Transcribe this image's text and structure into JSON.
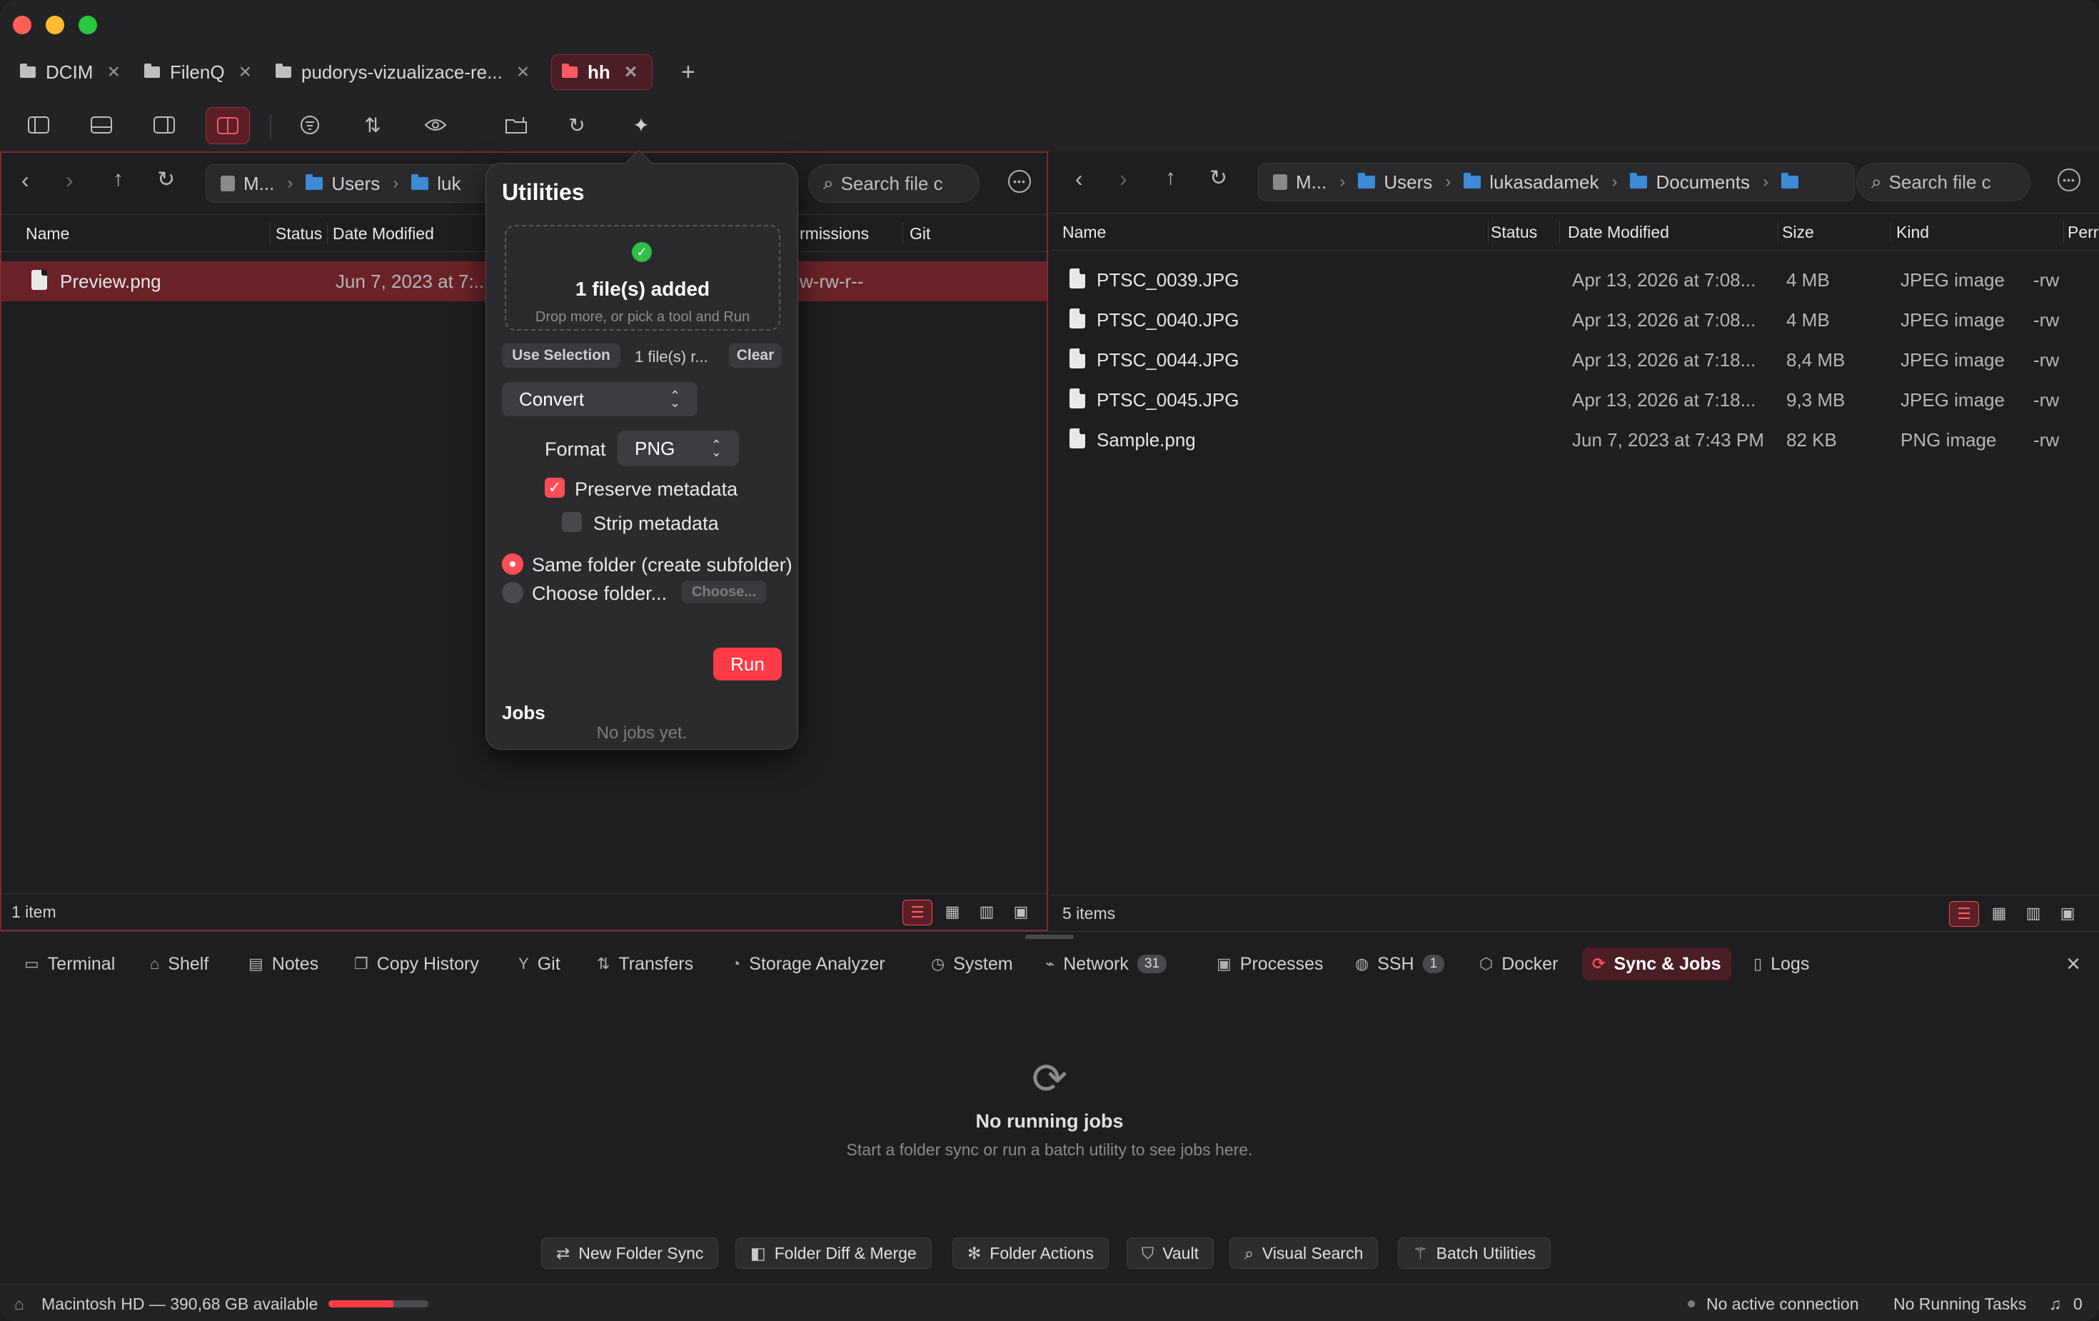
{
  "tabs": [
    {
      "label": "DCIM",
      "active": false
    },
    {
      "label": "FilenQ",
      "active": false
    },
    {
      "label": "pudorys-vizualizace-re...",
      "active": false
    },
    {
      "label": "hh",
      "active": true
    }
  ],
  "toolbar": {
    "icons": [
      "sidebar-toggle-icon",
      "top-panel-icon",
      "right-panel-icon",
      "dual-pane-icon",
      "filter-icon",
      "sort-icon",
      "preview-eye-icon",
      "new-folder-icon",
      "refresh-icon",
      "utilities-sparkle-icon"
    ],
    "accent": "#ff4d57"
  },
  "left_pane": {
    "breadcrumbs": [
      "M...",
      "Users",
      "luk"
    ],
    "search_placeholder": "Search file c",
    "columns": [
      "Name",
      "Status",
      "Date Modified",
      "rmissions",
      "Git"
    ],
    "files": [
      {
        "name": "Preview.png",
        "date": "Jun 7, 2023 at 7:..",
        "perm": "w-rw-r--",
        "selected": true
      }
    ],
    "status": "1 item"
  },
  "right_pane": {
    "breadcrumbs": [
      "M...",
      "Users",
      "lukasadamek",
      "Documents"
    ],
    "search_placeholder": "Search file c",
    "columns": [
      "Name",
      "Status",
      "Date Modified",
      "Size",
      "Kind",
      "Perr"
    ],
    "files": [
      {
        "name": "PTSC_0039.JPG",
        "date": "Apr 13, 2026 at 7:08...",
        "size": "4 MB",
        "kind": "JPEG image",
        "perm": "-rw"
      },
      {
        "name": "PTSC_0040.JPG",
        "date": "Apr 13, 2026 at 7:08...",
        "size": "4 MB",
        "kind": "JPEG image",
        "perm": "-rw"
      },
      {
        "name": "PTSC_0044.JPG",
        "date": "Apr 13, 2026 at 7:18...",
        "size": "8,4 MB",
        "kind": "JPEG image",
        "perm": "-rw"
      },
      {
        "name": "PTSC_0045.JPG",
        "date": "Apr 13, 2026 at 7:18...",
        "size": "9,3 MB",
        "kind": "JPEG image",
        "perm": "-rw"
      },
      {
        "name": "Sample.png",
        "date": "Jun 7, 2023 at 7:43 PM",
        "size": "82 KB",
        "kind": "PNG image",
        "perm": "-rw"
      }
    ],
    "status": "5 items"
  },
  "utilities": {
    "title": "Utilities",
    "dropzone_main": "1 file(s) added",
    "dropzone_sub": "Drop more, or pick a tool and Run",
    "use_selection": "Use Selection",
    "count_text": "1 file(s) r...",
    "clear": "Clear",
    "tool": "Convert",
    "format_label": "Format",
    "format_value": "PNG",
    "preserve_metadata": "Preserve metadata",
    "preserve_checked": true,
    "strip_metadata": "Strip metadata",
    "strip_checked": false,
    "dest_same": "Same folder (create subfolder)",
    "dest_choose": "Choose folder...",
    "choose_btn": "Choose...",
    "run": "Run",
    "jobs_title": "Jobs",
    "jobs_empty": "No jobs yet."
  },
  "panel": {
    "tabs": [
      {
        "label": "Terminal",
        "icon": "terminal-icon"
      },
      {
        "label": "Shelf",
        "icon": "shelf-icon"
      },
      {
        "label": "Notes",
        "icon": "notes-icon"
      },
      {
        "label": "Copy History",
        "icon": "clipboard-icon"
      },
      {
        "label": "Git",
        "icon": "git-branch-icon"
      },
      {
        "label": "Transfers",
        "icon": "transfer-arrows-icon"
      },
      {
        "label": "Storage Analyzer",
        "icon": "pie-chart-icon"
      },
      {
        "label": "System",
        "icon": "gauge-icon"
      },
      {
        "label": "Network",
        "icon": "network-chart-icon",
        "badge": "31"
      },
      {
        "label": "Processes",
        "icon": "cpu-icon"
      },
      {
        "label": "SSH",
        "icon": "globe-icon",
        "badge": "1"
      },
      {
        "label": "Docker",
        "icon": "cube-icon"
      },
      {
        "label": "Sync & Jobs",
        "icon": "sync-icon",
        "active": true
      },
      {
        "label": "Logs",
        "icon": "document-icon"
      }
    ],
    "empty_title": "No running jobs",
    "empty_sub": "Start a folder sync or run a batch utility to see jobs here.",
    "actions": [
      {
        "label": "New Folder Sync",
        "icon": "sync-arrows-icon"
      },
      {
        "label": "Folder Diff & Merge",
        "icon": "split-view-icon"
      },
      {
        "label": "Folder Actions",
        "icon": "sparkle-icon"
      },
      {
        "label": "Vault",
        "icon": "shield-icon"
      },
      {
        "label": "Visual Search",
        "icon": "search-icon"
      },
      {
        "label": "Batch Utilities",
        "icon": "wand-icon"
      }
    ]
  },
  "footer": {
    "disk": "Macintosh HD — 390,68 GB available",
    "disk_used_fraction": 0.65,
    "connection": "No active connection",
    "tasks": "No Running Tasks",
    "notifications": "0"
  }
}
